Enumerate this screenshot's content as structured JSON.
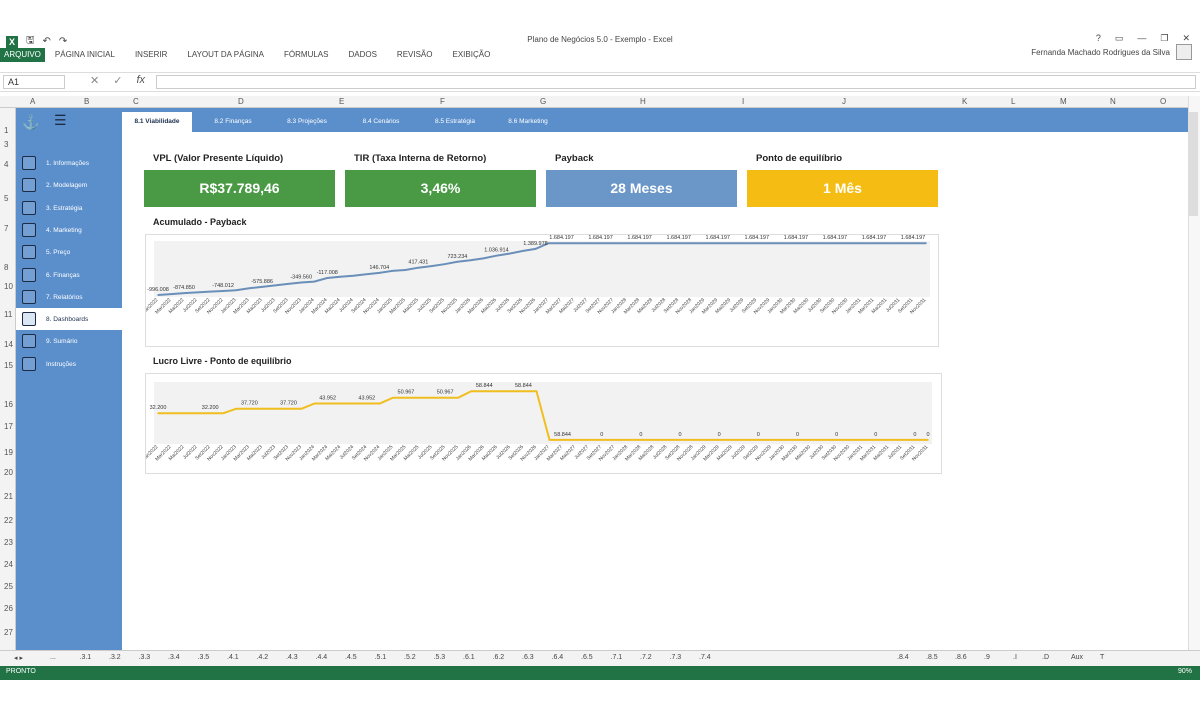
{
  "window": {
    "doc_title": "Plano de Negócios 5.0 - Exemplo - Excel",
    "user_name": "Fernanda Machado Rodrigues da Silva",
    "controls": [
      "?",
      "▭",
      "—",
      "❐",
      "✕"
    ]
  },
  "ribbon_tabs": [
    "ARQUIVO",
    "PÁGINA INICIAL",
    "INSERIR",
    "LAYOUT DA PÁGINA",
    "FÓRMULAS",
    "DADOS",
    "REVISÃO",
    "EXIBIÇÃO"
  ],
  "formula_bar": {
    "name_box": "A1",
    "fx": "fx",
    "value": ""
  },
  "columns": [
    {
      "label": "A"
    },
    {
      "label": "B"
    },
    {
      "label": "C"
    },
    {
      "label": "D"
    },
    {
      "label": "E"
    },
    {
      "label": "F"
    },
    {
      "label": "G"
    },
    {
      "label": "H"
    },
    {
      "label": "I"
    },
    {
      "label": "J"
    },
    {
      "label": "K"
    },
    {
      "label": "L"
    },
    {
      "label": "M"
    },
    {
      "label": "N"
    },
    {
      "label": "O"
    }
  ],
  "rows": [
    "1",
    "3",
    "4",
    "5",
    "7",
    "8",
    "10",
    "11",
    "14",
    "15",
    "16",
    "17",
    "19",
    "20",
    "21",
    "22",
    "23",
    "24",
    "25",
    "26",
    "27"
  ],
  "sidebar": [
    {
      "label": "1. Informações",
      "icon": "info-icon"
    },
    {
      "label": "2. Modelagem",
      "icon": "model-icon"
    },
    {
      "label": "3. Estratégia",
      "icon": "strategy-icon"
    },
    {
      "label": "4. Marketing",
      "icon": "target-icon"
    },
    {
      "label": "5. Preço",
      "icon": "price-icon"
    },
    {
      "label": "6. Finanças",
      "icon": "finance-icon"
    },
    {
      "label": "7. Relatórios",
      "icon": "report-icon"
    },
    {
      "label": "8. Dashboards",
      "icon": "dashboard-icon",
      "active": true
    },
    {
      "label": "9. Sumário",
      "icon": "summary-icon"
    },
    {
      "label": "Instruções",
      "icon": "instructions-icon"
    }
  ],
  "tabs": [
    {
      "label": "8.1 Viabilidade",
      "active": true
    },
    {
      "label": "8.2 Finanças"
    },
    {
      "label": "8.3 Projeções"
    },
    {
      "label": "8.4 Cenários"
    },
    {
      "label": "8.5 Estratégia"
    },
    {
      "label": "8.6 Marketing"
    }
  ],
  "kpis": [
    {
      "label": "VPL (Valor Presente Líquido)",
      "value": "R$37.789,46",
      "color": "#4a9a45"
    },
    {
      "label": "TIR (Taxa Interna de Retorno)",
      "value": "3,46%",
      "color": "#4a9a45"
    },
    {
      "label": "Payback",
      "value": "28 Meses",
      "color": "#6a96c8"
    },
    {
      "label": "Ponto de equilíbrio",
      "value": "1 Mês",
      "color": "#f5bd14"
    }
  ],
  "chart_data": [
    {
      "type": "line",
      "title": "Acumulado - Payback",
      "color": "#6a8fb8",
      "x": [
        "Jan2022",
        "Mar2022",
        "Mai2022",
        "Jul2022",
        "Set2022",
        "Nov2022",
        "Jan2023",
        "Mar2023",
        "Mai2023",
        "Jul2023",
        "Set2023",
        "Nov2023",
        "Jan2024",
        "Mar2024",
        "Mai2024",
        "Jul2024",
        "Set2024",
        "Nov2024",
        "Jan2025",
        "Mar2025",
        "Mai2025",
        "Jul2025",
        "Set2025",
        "Nov2025",
        "Jan2026",
        "Mar2026",
        "Mai2026",
        "Jul2026",
        "Set2026",
        "Nov2026",
        "Jan2027",
        "Mar2027",
        "Mai2027",
        "Jul2027",
        "Set2027",
        "Nov2027",
        "Jan2028",
        "Mar2028",
        "Mai2028",
        "Jul2028",
        "Set2028",
        "Nov2028",
        "Jan2029",
        "Mar2029",
        "Mai2029",
        "Jul2029",
        "Set2029",
        "Nov2029",
        "Jan2030",
        "Mar2030",
        "Mai2030",
        "Jul2030",
        "Set2030",
        "Nov2030",
        "Jan2031",
        "Mar2031",
        "Mai2031",
        "Jul2031",
        "Set2031",
        "Nov2031"
      ],
      "values": [
        -996.008,
        -950,
        -900,
        -860,
        -820,
        -790,
        -748,
        -650,
        -575.886,
        -500,
        -420,
        -349.56,
        -300,
        -117.008,
        -50,
        0,
        80,
        146.704,
        250,
        300,
        417.431,
        500,
        600,
        723.234,
        800,
        900,
        1036.914,
        1150,
        1280,
        1389.978,
        1684.197,
        1684.197,
        1684.197,
        1684.197,
        1684.197,
        1684.197,
        1684.197,
        1684.197,
        1684.197,
        1684.197,
        1684.197,
        1684.197,
        1684.197,
        1684.197,
        1684.197,
        1684.197,
        1684.197,
        1684.197,
        1684.197,
        1684.197,
        1684.197,
        1684.197,
        1684.197,
        1684.197,
        1684.197,
        1684.197,
        1684.197,
        1684.197,
        1684.197,
        1684.197
      ],
      "data_labels": [
        {
          "i": 0,
          "text": "-996.008"
        },
        {
          "i": 2,
          "text": "-874.850"
        },
        {
          "i": 5,
          "text": "-748.012"
        },
        {
          "i": 8,
          "text": "-575.886"
        },
        {
          "i": 11,
          "text": "-349.560"
        },
        {
          "i": 13,
          "text": "-117.008"
        },
        {
          "i": 17,
          "text": "146.704"
        },
        {
          "i": 20,
          "text": "417.431"
        },
        {
          "i": 23,
          "text": "723.234"
        },
        {
          "i": 26,
          "text": "1.036.914"
        },
        {
          "i": 29,
          "text": "1.389.978"
        },
        {
          "i": 31,
          "text": "1.684.197"
        },
        {
          "i": 34,
          "text": "1.684.197"
        },
        {
          "i": 37,
          "text": "1.684.197"
        },
        {
          "i": 40,
          "text": "1.684.197"
        },
        {
          "i": 43,
          "text": "1.684.197"
        },
        {
          "i": 46,
          "text": "1.684.197"
        },
        {
          "i": 49,
          "text": "1.684.197"
        },
        {
          "i": 52,
          "text": "1.684.197"
        },
        {
          "i": 55,
          "text": "1.684.197"
        },
        {
          "i": 58,
          "text": "1.684.197"
        }
      ],
      "ylim": [
        -1100,
        1800
      ]
    },
    {
      "type": "line",
      "title": "Lucro Livre - Ponto de equilíbrio",
      "color": "#f0be1e",
      "x": [
        "Jan2022",
        "Mar2022",
        "Mai2022",
        "Jul2022",
        "Set2022",
        "Nov2022",
        "Jan2023",
        "Mar2023",
        "Mai2023",
        "Jul2023",
        "Set2023",
        "Nov2023",
        "Jan2024",
        "Mar2024",
        "Mai2024",
        "Jul2024",
        "Set2024",
        "Nov2024",
        "Jan2025",
        "Mar2025",
        "Mai2025",
        "Jul2025",
        "Set2025",
        "Nov2025",
        "Jan2026",
        "Mar2026",
        "Mai2026",
        "Jul2026",
        "Set2026",
        "Nov2026",
        "Jan2027",
        "Mar2027",
        "Mai2027",
        "Jul2027",
        "Set2027",
        "Nov2027",
        "Jan2028",
        "Mar2028",
        "Mai2028",
        "Jul2028",
        "Set2028",
        "Nov2028",
        "Jan2029",
        "Mar2029",
        "Mai2029",
        "Jul2029",
        "Set2029",
        "Nov2029",
        "Jan2030",
        "Mar2030",
        "Mai2030",
        "Jul2030",
        "Set2030",
        "Nov2030",
        "Jan2031",
        "Mar2031",
        "Mai2031",
        "Jul2031",
        "Set2031",
        "Nov2031"
      ],
      "values": [
        32.2,
        32.2,
        32.2,
        32.2,
        32.2,
        32.2,
        37.72,
        37.72,
        37.72,
        37.72,
        37.72,
        37.72,
        43.952,
        43.952,
        43.952,
        43.952,
        43.952,
        43.952,
        50.967,
        50.967,
        50.967,
        50.967,
        50.967,
        50.967,
        58.844,
        58.844,
        58.844,
        58.844,
        58.844,
        58.844,
        0,
        0,
        0,
        0,
        0,
        0,
        0,
        0,
        0,
        0,
        0,
        0,
        0,
        0,
        0,
        0,
        0,
        0,
        0,
        0,
        0,
        0,
        0,
        0,
        0,
        0,
        0,
        0,
        0,
        0
      ],
      "data_labels": [
        {
          "i": 0,
          "text": "32.200"
        },
        {
          "i": 4,
          "text": "32.200"
        },
        {
          "i": 7,
          "text": "37.720"
        },
        {
          "i": 10,
          "text": "37.720"
        },
        {
          "i": 13,
          "text": "43.952"
        },
        {
          "i": 16,
          "text": "43.952"
        },
        {
          "i": 19,
          "text": "50.967"
        },
        {
          "i": 22,
          "text": "50.967"
        },
        {
          "i": 25,
          "text": "58.844"
        },
        {
          "i": 28,
          "text": "58.844"
        },
        {
          "i": 31,
          "text": "58.844"
        },
        {
          "i": 34,
          "text": "0"
        },
        {
          "i": 37,
          "text": "0"
        },
        {
          "i": 40,
          "text": "0"
        },
        {
          "i": 43,
          "text": "0"
        },
        {
          "i": 46,
          "text": "0"
        },
        {
          "i": 49,
          "text": "0"
        },
        {
          "i": 52,
          "text": "0"
        },
        {
          "i": 55,
          "text": "0"
        },
        {
          "i": 58,
          "text": "0"
        },
        {
          "i": 59,
          "text": "0"
        }
      ],
      "ylim": [
        -5,
        70
      ]
    }
  ],
  "sheet_tabs": [
    "...",
    ".3.1",
    ".3.2",
    ".3.3",
    ".3.4",
    ".3.5",
    ".4.1",
    ".4.2",
    ".4.3",
    ".4.4",
    ".4.5",
    ".5.1",
    ".5.2",
    ".5.3",
    ".6.1",
    ".6.2",
    ".6.3",
    ".6.4",
    ".6.5",
    ".7.1",
    ".7.2",
    ".7.3",
    ".7.4",
    ".8.4",
    ".8.5",
    ".8.6",
    ".9",
    ".I",
    ".D",
    "Aux",
    "T"
  ],
  "status": {
    "text": "PRONTO",
    "zoom": "90%"
  }
}
